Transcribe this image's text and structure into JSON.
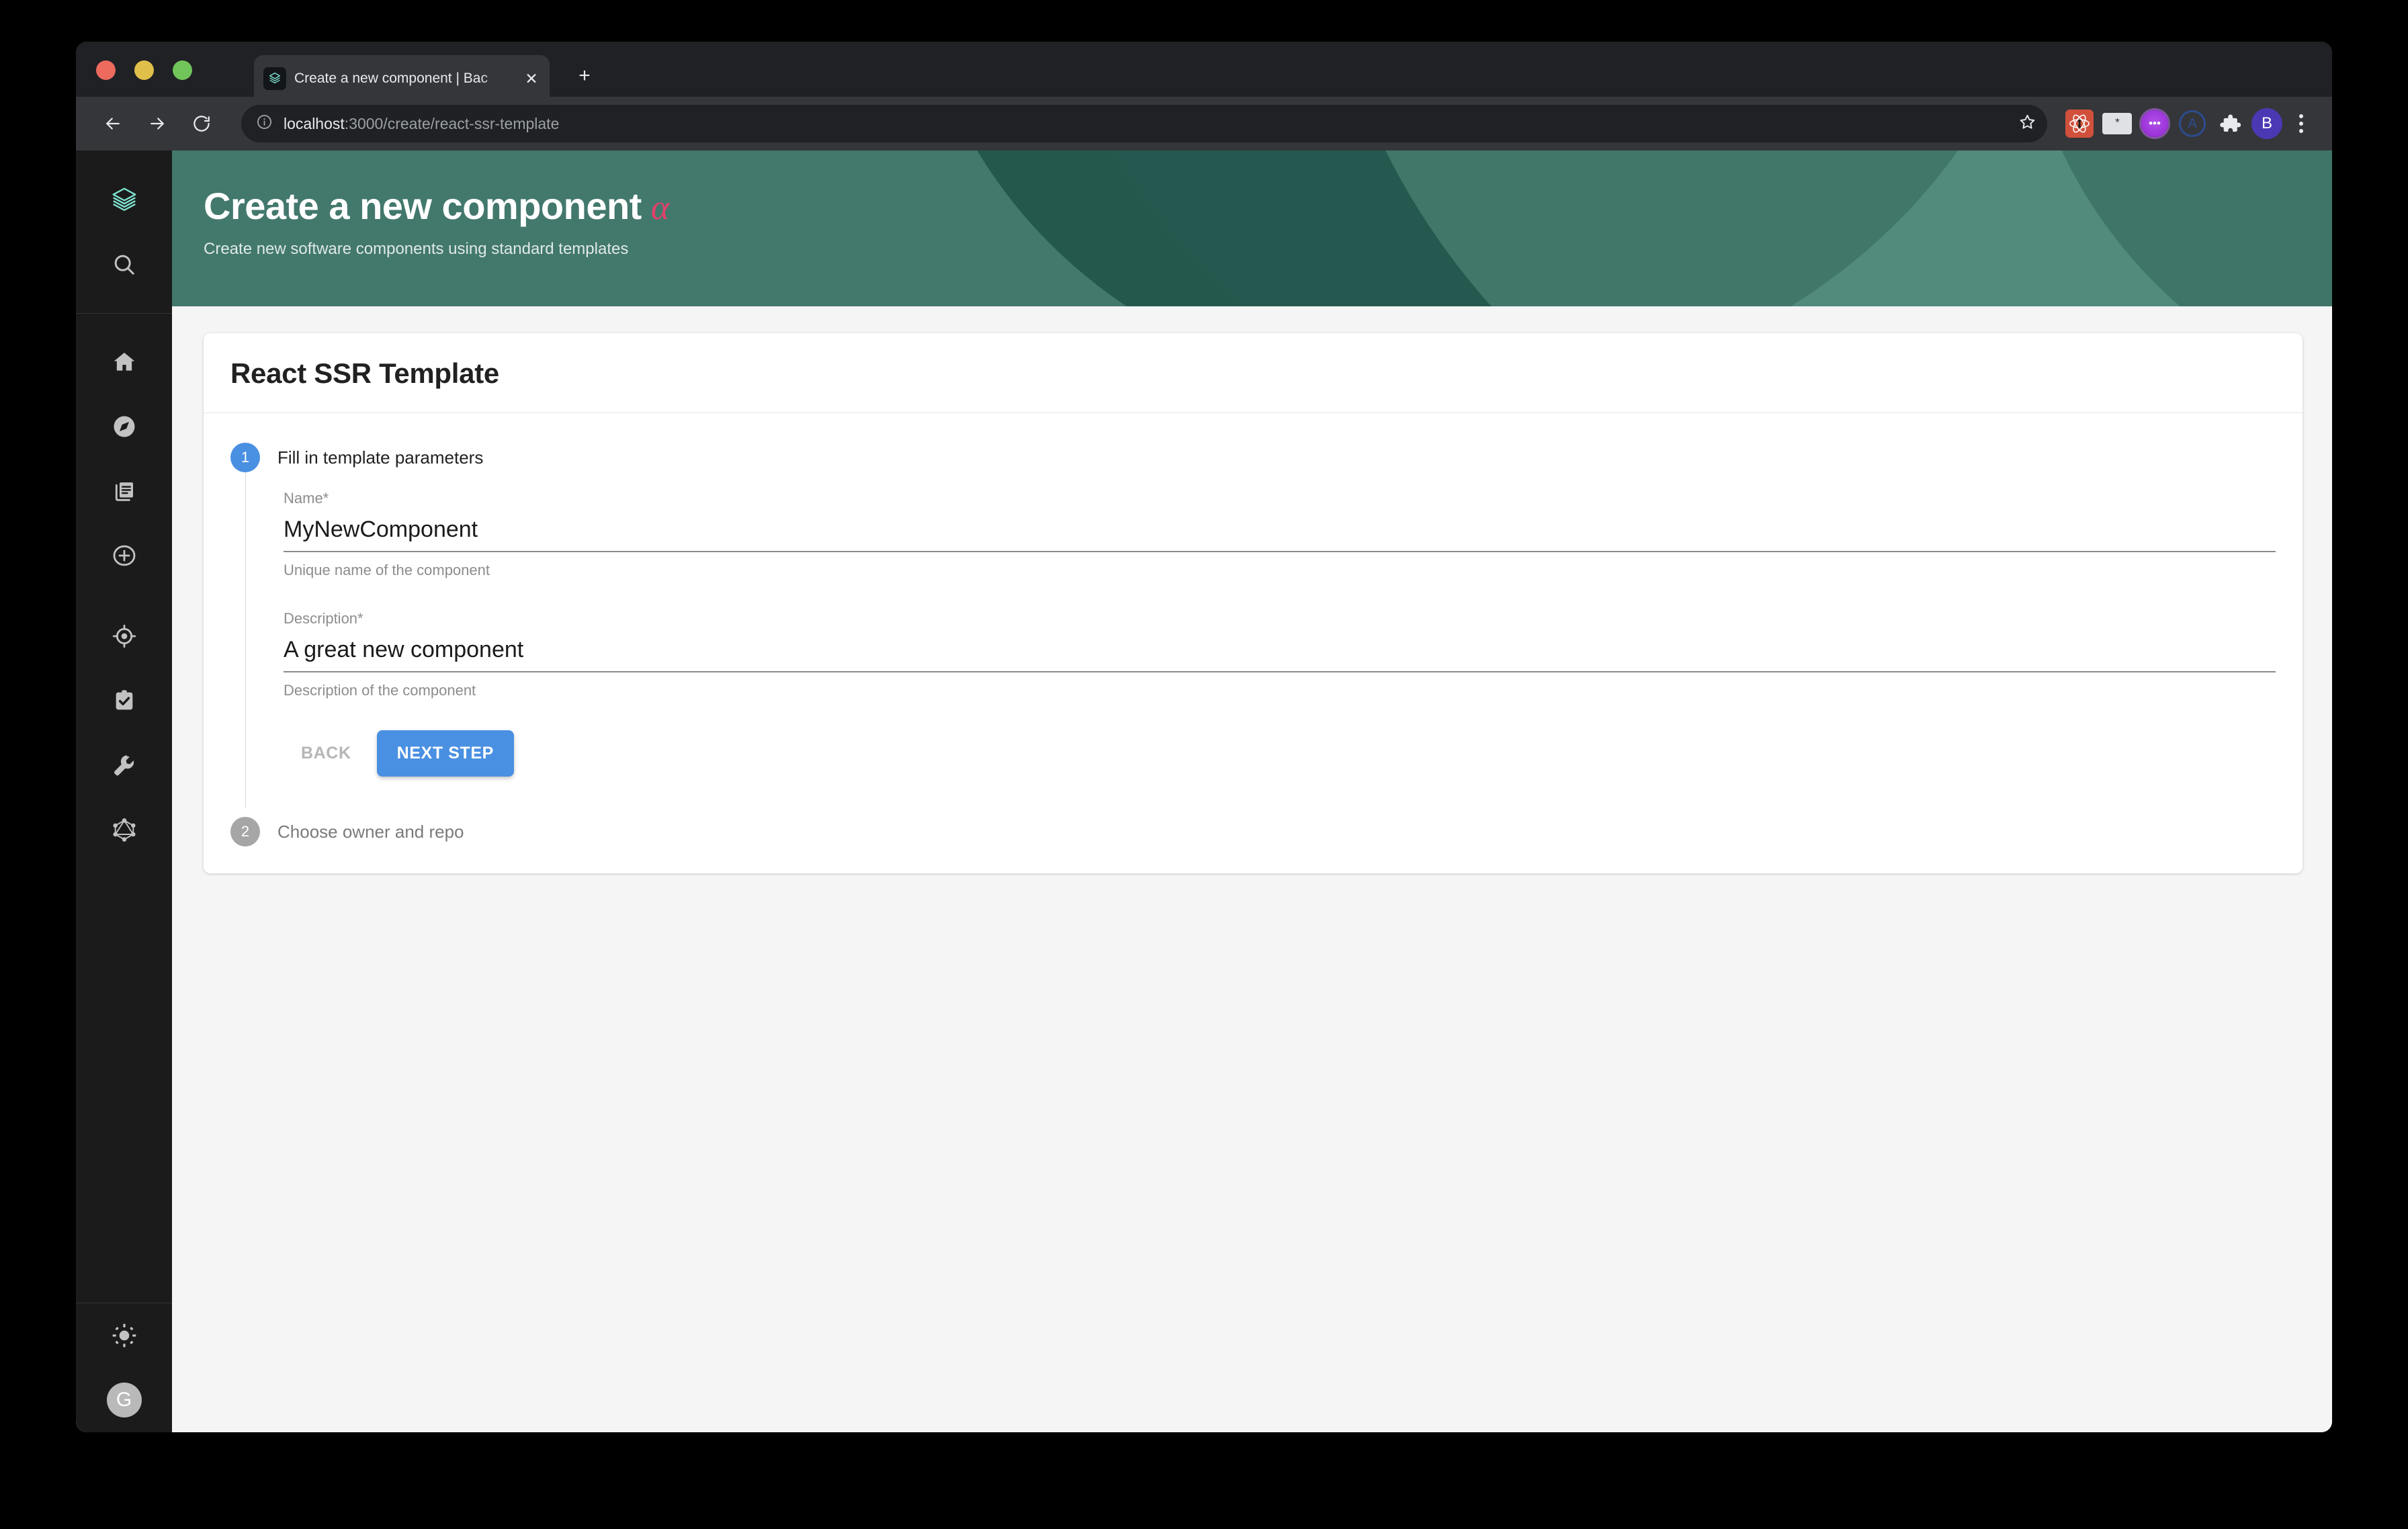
{
  "browser": {
    "tab": {
      "title": "Create a new component | Bac",
      "favicon_icon": "backstage-logo-icon",
      "close_icon": "close-icon"
    },
    "new_tab_icon": "plus-icon",
    "nav": {
      "back_icon": "arrow-left-icon",
      "forward_icon": "arrow-right-icon",
      "reload_icon": "reload-icon"
    },
    "omnibox": {
      "info_icon": "info-circle-icon",
      "url_host": "localhost",
      "url_path": ":3000/create/react-ssr-template",
      "bookmark_icon": "star-icon"
    },
    "toolbar_icons": [
      "react-devtools-icon",
      "terminal-icon",
      "purple-chat-icon",
      "circle-a-icon",
      "puzzle-extensions-icon"
    ],
    "extension_terminal_label": "*",
    "extension_purple_label": "•••",
    "extension_a_label": "A",
    "profile_avatar_label": "B",
    "menu_icon": "three-dot-menu-icon"
  },
  "sidebar": {
    "logo_icon": "backstage-logo-icon",
    "items": [
      {
        "name": "search",
        "icon": "search-icon"
      },
      {
        "name": "home",
        "icon": "home-icon"
      },
      {
        "name": "explore",
        "icon": "compass-icon"
      },
      {
        "name": "docs",
        "icon": "docs-icon"
      },
      {
        "name": "create",
        "icon": "plus-circle-icon"
      },
      {
        "name": "tech-radar",
        "icon": "target-icon"
      },
      {
        "name": "tasks",
        "icon": "clipboard-check-icon"
      },
      {
        "name": "tools",
        "icon": "wrench-icon"
      },
      {
        "name": "graphiql",
        "icon": "graphql-icon"
      }
    ],
    "theme_toggle_icon": "sun-icon",
    "user_avatar_label": "G"
  },
  "header": {
    "title": "Create a new component",
    "alpha_badge": "α",
    "subtitle": "Create new software components using standard templates",
    "background_color": "#43786d",
    "accent_color": "#e4406a"
  },
  "card": {
    "title": "React SSR Template"
  },
  "stepper": {
    "accent_color": "#4a90e2",
    "steps": [
      {
        "number": "1",
        "label": "Fill in template parameters",
        "state": "active"
      },
      {
        "number": "2",
        "label": "Choose owner and repo",
        "state": "inactive"
      }
    ]
  },
  "form": {
    "fields": [
      {
        "label": "Name*",
        "value": "MyNewComponent",
        "placeholder": "",
        "help": "Unique name of the component"
      },
      {
        "label": "Description*",
        "value": "A great new component",
        "placeholder": "",
        "help": "Description of the component"
      }
    ],
    "back_label": "BACK",
    "next_label": "NEXT STEP"
  }
}
